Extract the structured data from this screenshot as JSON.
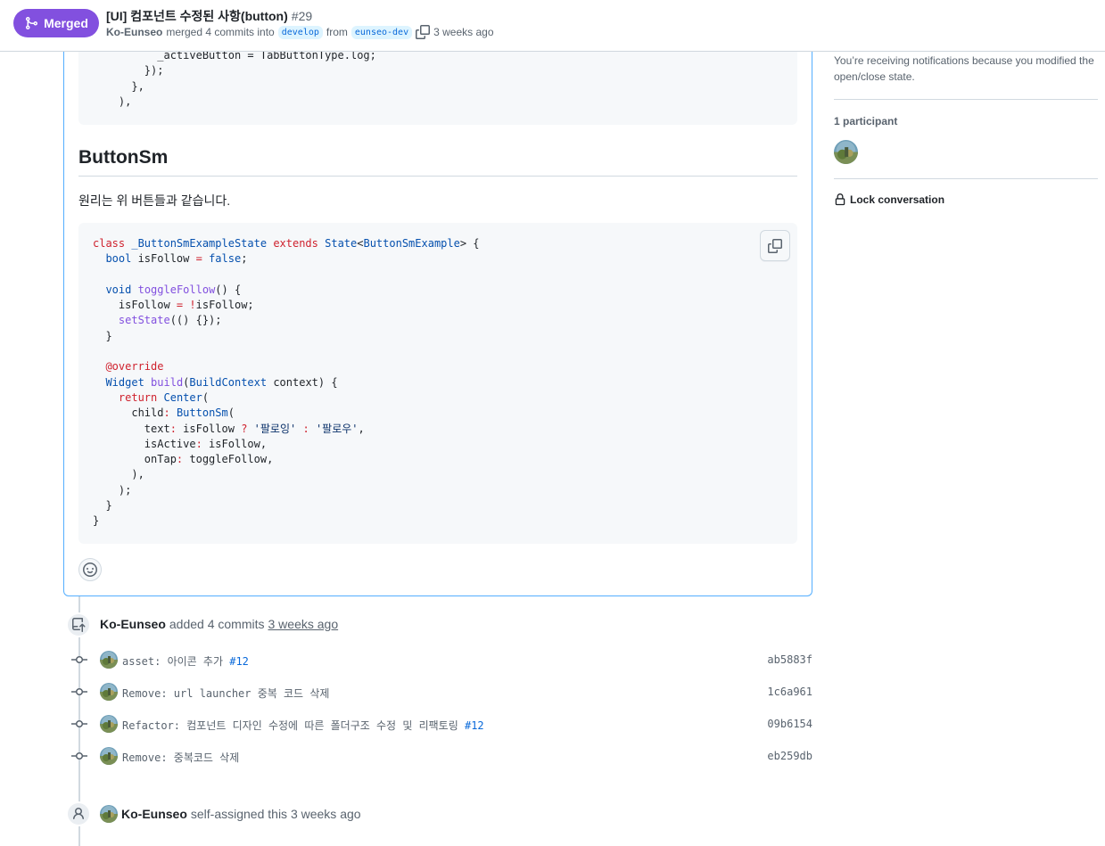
{
  "header": {
    "status": "Merged",
    "title": "[UI] 컴포넌트 수정된 사항(button)",
    "number": "#29",
    "author": "Ko-Eunseo",
    "merged_text": "merged 4 commits into",
    "base_branch": "develop",
    "from_text": "from",
    "head_branch": "eunseo-dev",
    "time": "3 weeks ago"
  },
  "comment": {
    "code_top_lines": [
      "          _activeButton = TabButtonType.log;",
      "        });",
      "      },",
      "    ),"
    ],
    "heading": "ButtonSm",
    "description": "원리는 위 버튼들과 같습니다."
  },
  "sidebar": {
    "notification_text": "You’re receiving notifications because you modified the open/close state.",
    "participants_title": "1 participant",
    "lock_label": "Lock conversation"
  },
  "timeline": {
    "commits_event": {
      "actor": "Ko-Eunseo",
      "action": "added 4 commits",
      "time": "3 weeks ago"
    },
    "commits": [
      {
        "message": "asset: 아이콘 추가",
        "ref": "#12",
        "sha": "ab5883f"
      },
      {
        "message": "Remove: url launcher 중복 코드 삭제",
        "ref": "",
        "sha": "1c6a961"
      },
      {
        "message": "Refactor: 컴포넌트 디자인 수정에 따른 폴더구조 수정 및 리팩토링",
        "ref": "#12",
        "sha": "09b6154"
      },
      {
        "message": "Remove: 중복코드 삭제",
        "ref": "",
        "sha": "eb259db"
      }
    ],
    "assign_event": {
      "actor": "Ko-Eunseo",
      "action": "self-assigned this 3 weeks ago"
    }
  },
  "colors": {
    "merged": "#8250df",
    "link": "#0969da",
    "border": "#d1d9e0",
    "focus_border": "#54aeff"
  }
}
